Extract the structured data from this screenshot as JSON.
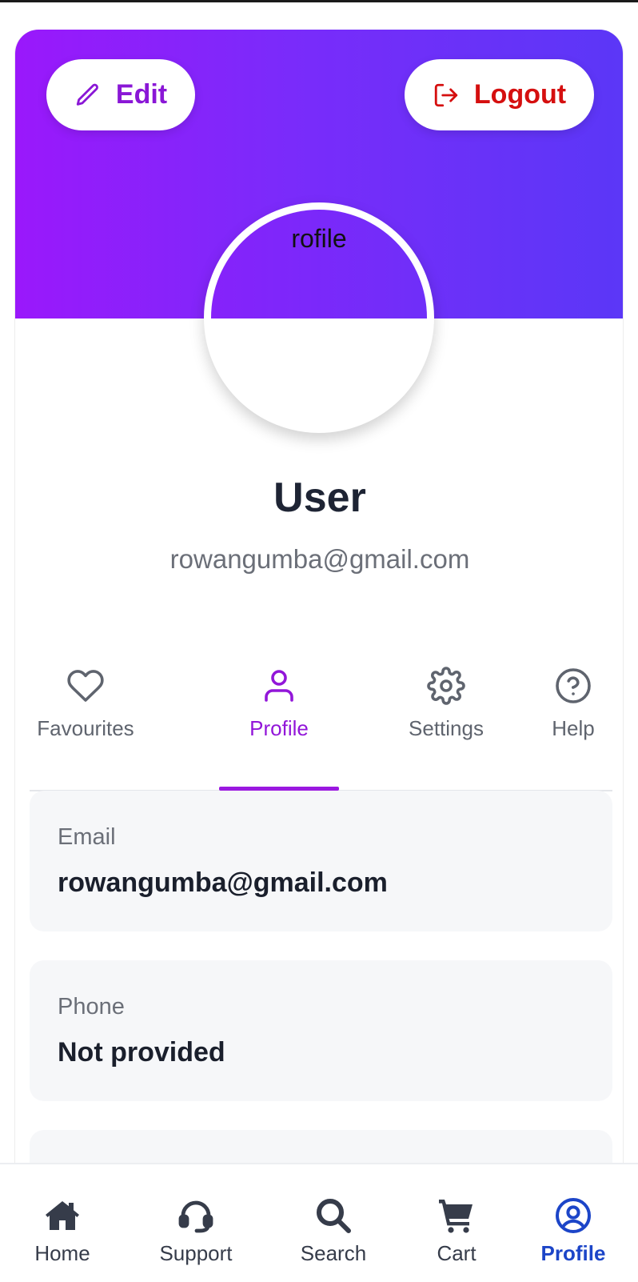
{
  "header": {
    "edit_label": "Edit",
    "logout_label": "Logout",
    "avatar_alt_text": "rofile"
  },
  "user": {
    "name": "User",
    "email": "rowangumba@gmail.com"
  },
  "tabs": [
    {
      "label": "Favourites",
      "icon": "heart-icon",
      "active": false
    },
    {
      "label": "Profile",
      "icon": "user-icon",
      "active": true
    },
    {
      "label": "Settings",
      "icon": "gear-icon",
      "active": false
    },
    {
      "label": "Help",
      "icon": "help-circle-icon",
      "active": false
    }
  ],
  "fields": [
    {
      "label": "Email",
      "value": "rowangumba@gmail.com"
    },
    {
      "label": "Phone",
      "value": "Not provided"
    }
  ],
  "bottom_nav": [
    {
      "label": "Home",
      "icon": "home-icon",
      "active": false
    },
    {
      "label": "Support",
      "icon": "headset-icon",
      "active": false
    },
    {
      "label": "Search",
      "icon": "search-icon",
      "active": false
    },
    {
      "label": "Cart",
      "icon": "cart-icon",
      "active": false
    },
    {
      "label": "Profile",
      "icon": "user-circle-icon",
      "active": true
    }
  ],
  "colors": {
    "gradient_start": "#9a18fb",
    "gradient_end": "#5b37f7",
    "edit_color": "#8a17d6",
    "logout_color": "#d50f0f",
    "active_tab": "#9216d9",
    "active_nav": "#1c45c8"
  }
}
